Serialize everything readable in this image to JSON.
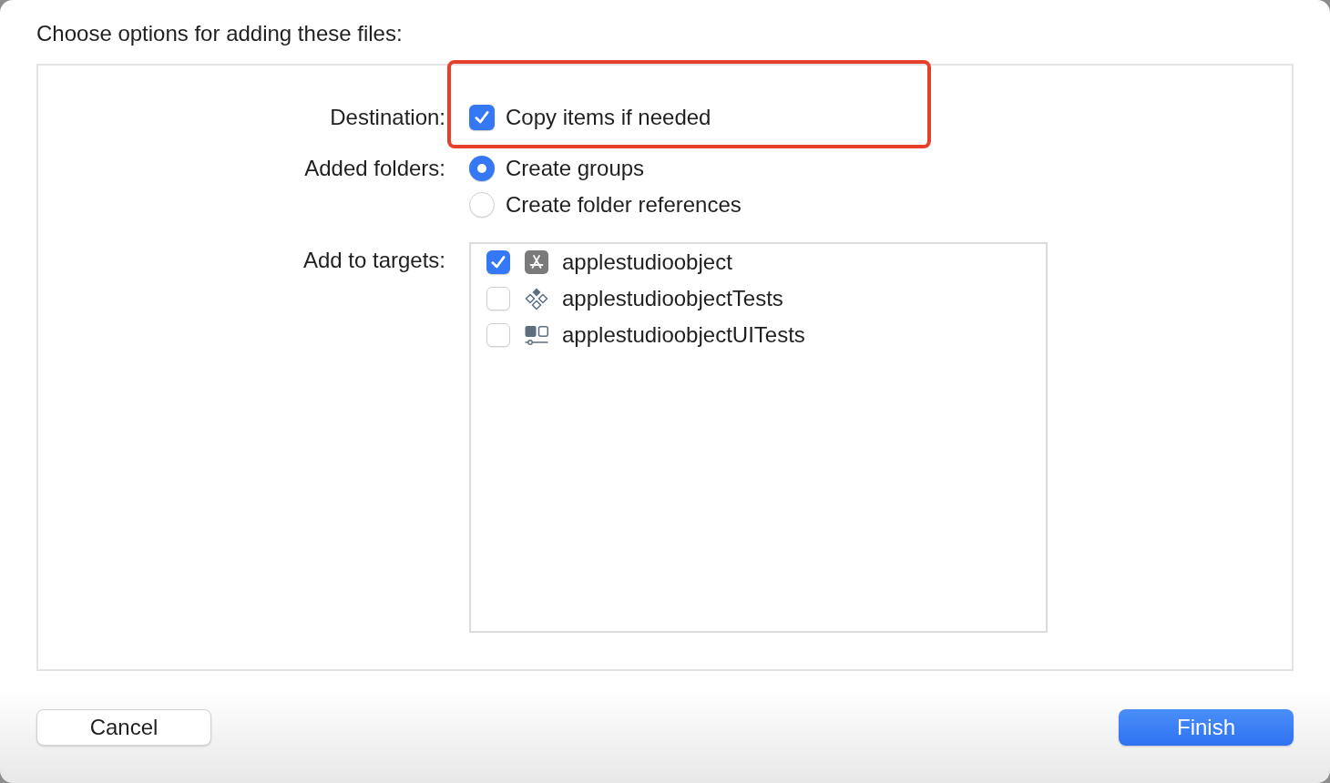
{
  "title": "Choose options for adding these files:",
  "destination": {
    "label": "Destination:",
    "option": {
      "label": "Copy items if needed",
      "checked": true
    },
    "highlighted": true
  },
  "added_folders": {
    "label": "Added folders:",
    "options": [
      {
        "label": "Create groups",
        "selected": true
      },
      {
        "label": "Create folder references",
        "selected": false
      }
    ]
  },
  "targets": {
    "label": "Add to targets:",
    "items": [
      {
        "name": "applestudioobject",
        "kind": "app",
        "checked": true
      },
      {
        "name": "applestudioobjectTests",
        "kind": "unit-tests",
        "checked": false
      },
      {
        "name": "applestudioobjectUITests",
        "kind": "ui-tests",
        "checked": false
      }
    ]
  },
  "buttons": [
    {
      "label": "Cancel",
      "kind": "secondary"
    },
    {
      "label": "Finish",
      "kind": "primary"
    }
  ]
}
